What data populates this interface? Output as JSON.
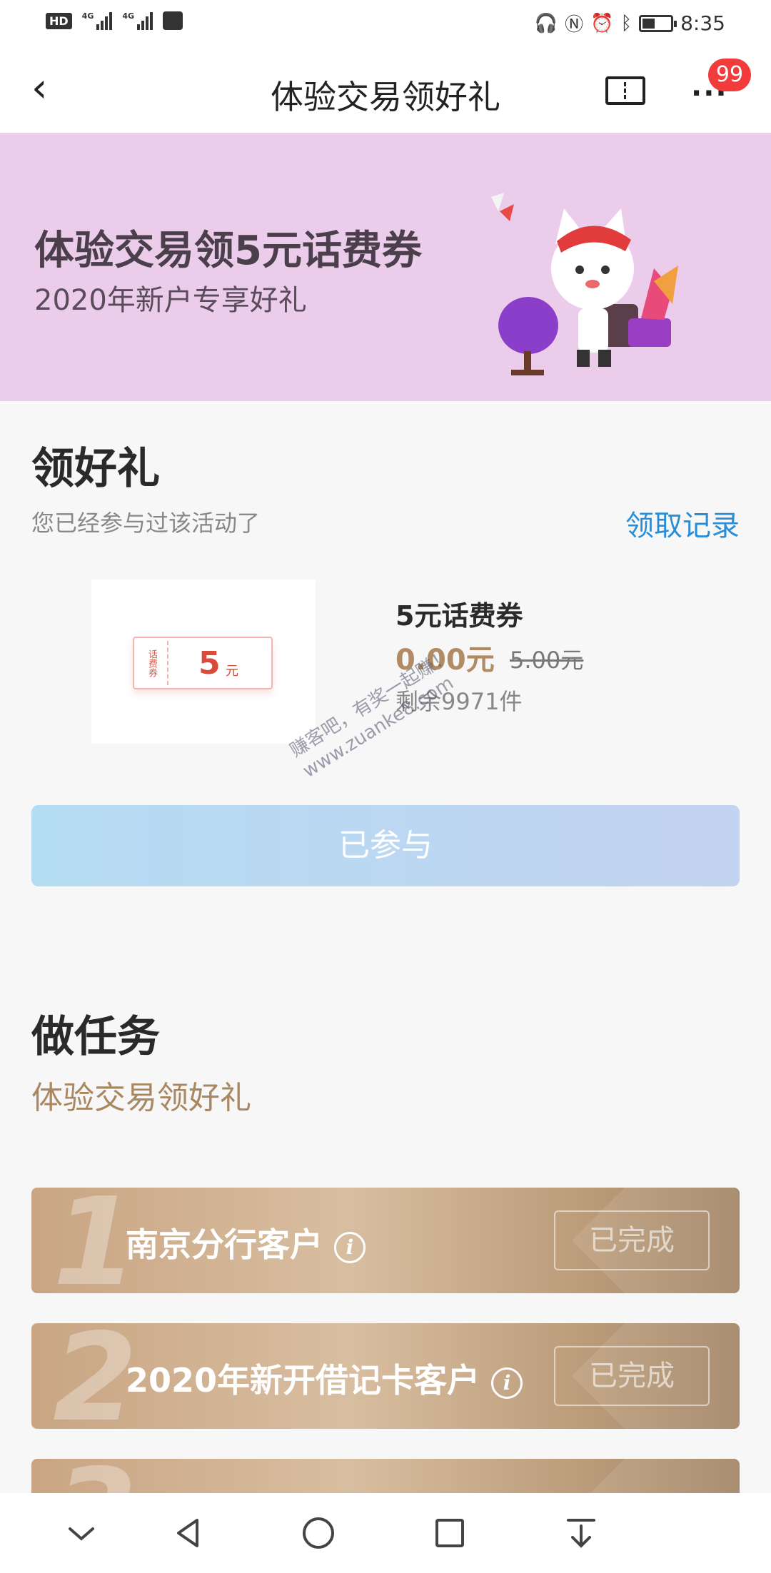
{
  "status_bar": {
    "hd": "HD",
    "net1": "4G",
    "net2": "4G",
    "time": "8:35",
    "battery_level": 0.4,
    "icons": [
      "headset-icon",
      "nfc-icon",
      "alarm-icon",
      "bluetooth-icon",
      "battery-icon"
    ]
  },
  "navbar": {
    "title": "体验交易领好礼",
    "badge": "99",
    "more": "···"
  },
  "banner": {
    "title": "体验交易领5元话费券",
    "subtitle": "2020年新户专享好礼"
  },
  "gift": {
    "section_title": "领好礼",
    "note": "您已经参与过该活动了",
    "records_link": "领取记录",
    "coupon": {
      "stub_text": "话费券",
      "amount": "5",
      "unit": "元"
    },
    "product": {
      "name": "5元话费券",
      "price": "0.00元",
      "original_price": "5.00元",
      "stock": "剩余9971件"
    },
    "button": "已参与",
    "watermark_line1": "赚客吧，有奖一起赚！",
    "watermark_line2": "www.zuanke8.com"
  },
  "tasks": {
    "section_title": "做任务",
    "subtitle": "体验交易领好礼",
    "items": [
      {
        "num": "1",
        "label": "南京分行客户",
        "status": "已完成"
      },
      {
        "num": "2",
        "label": "2020年新开借记卡客户",
        "status": "已完成"
      },
      {
        "num": "3",
        "label": "",
        "status": ""
      }
    ]
  },
  "colors": {
    "banner_bg": "#ebcdeb",
    "link": "#2a8ed6",
    "price": "#b08b63",
    "task_card": "#c9a583",
    "badge": "#f23b3b"
  }
}
